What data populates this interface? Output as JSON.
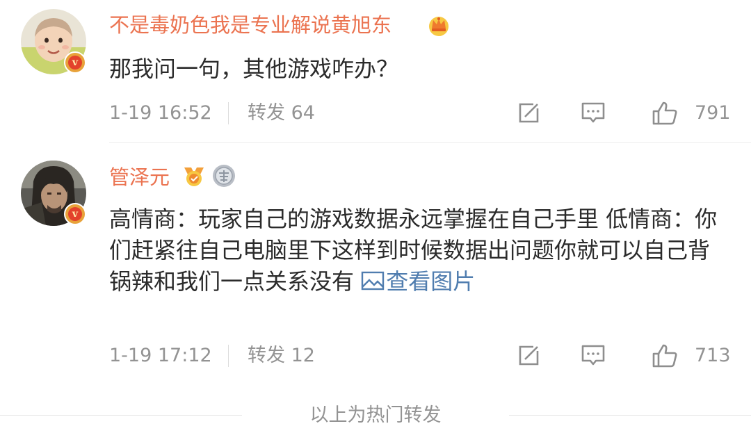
{
  "comments": [
    {
      "username": "不是毒奶色我是专业解说黄旭东",
      "text": "那我问一句，其他游戏咋办？",
      "time": "1-19 16:52",
      "repost": "转发 64",
      "likes": "791",
      "badges": [
        "crown-icon"
      ]
    },
    {
      "username": "管泽元",
      "text": "高情商：玩家自己的游戏数据永远掌握在自己手里 低情商：你们赶紧往自己电脑里下这样到时候数据出问题你就可以自己背锅辣和我们一点关系没有 ",
      "link": "查看图片",
      "time": "1-19 17:12",
      "repost": "转发 12",
      "likes": "713",
      "badges": [
        "medal-icon",
        "silver-medal-icon"
      ]
    }
  ],
  "footer": {
    "hot_label": "以上为热门转发"
  },
  "verified_mark": "v",
  "colors": {
    "username": "#eb7350",
    "link": "#507daf",
    "meta": "#939393",
    "verified": "#e3422c"
  }
}
